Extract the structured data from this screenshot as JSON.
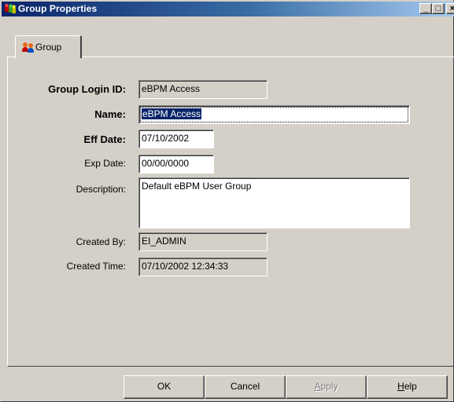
{
  "window": {
    "title": "Group Properties",
    "controls": {
      "minimize": "_",
      "maximize": "□",
      "close": "×"
    }
  },
  "tabs": [
    {
      "label": "Group",
      "icon": "group-icon"
    }
  ],
  "form": {
    "group_login_id": {
      "label": "Group Login ID:",
      "value": "eBPM Access"
    },
    "name": {
      "label": "Name:",
      "value": "eBPM Access"
    },
    "eff_date": {
      "label": "Eff Date:",
      "value": "07/10/2002"
    },
    "exp_date": {
      "label": "Exp Date:",
      "value": "00/00/0000"
    },
    "description": {
      "label": "Description:",
      "value": "Default eBPM User Group"
    },
    "created_by": {
      "label": "Created By:",
      "value": "EI_ADMIN"
    },
    "created_time": {
      "label": "Created Time:",
      "value": "07/10/2002 12:34:33"
    }
  },
  "buttons": {
    "ok": "OK",
    "cancel": "Cancel",
    "apply": {
      "first": "A",
      "rest": "pply"
    },
    "help": {
      "first": "H",
      "rest": "elp"
    }
  },
  "colors": {
    "titlebar_start": "#0a246a",
    "titlebar_end": "#a6caf0",
    "face": "#d4d0c8",
    "selection": "#0a246a"
  }
}
